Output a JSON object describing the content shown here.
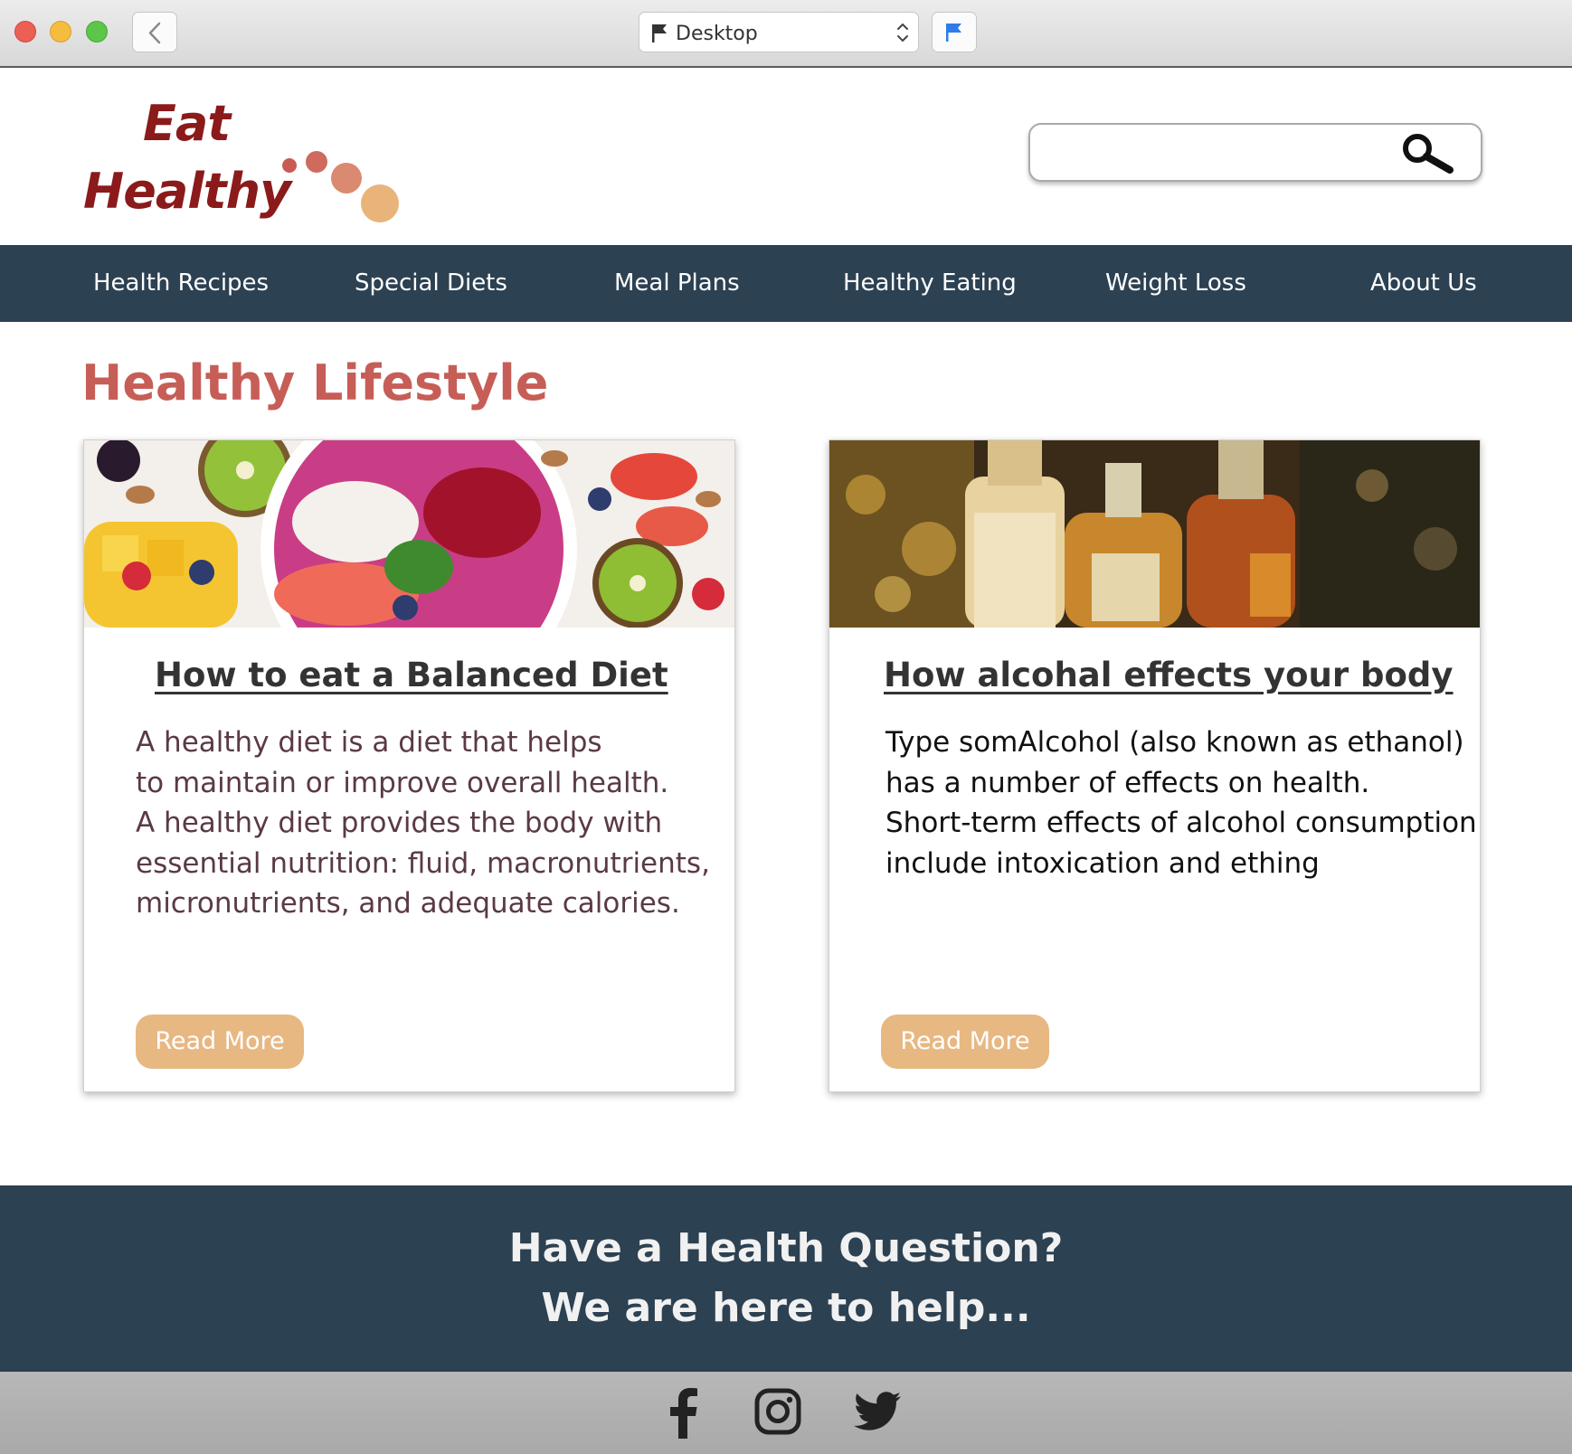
{
  "browser": {
    "device_label": "Desktop",
    "icons": [
      "back-chevron-icon",
      "flag-icon",
      "updown-icon",
      "flag-blue-icon"
    ]
  },
  "logo": {
    "line1": "Eat",
    "line2": "Healthy"
  },
  "search": {
    "placeholder": "",
    "value": ""
  },
  "nav": {
    "items": [
      {
        "label": "Health Recipes"
      },
      {
        "label": "Special Diets"
      },
      {
        "label": "Meal Plans"
      },
      {
        "label": "Healthy Eating"
      },
      {
        "label": "Weight Loss"
      },
      {
        "label": "About Us"
      }
    ]
  },
  "main": {
    "title": "Healthy Lifestyle",
    "cards": [
      {
        "title": "How to eat a Balanced Diet",
        "body_lines": [
          "A healthy diet is a diet that helps",
          "to maintain or improve overall health.",
          "A healthy diet provides the body with",
          "essential nutrition: fluid, macronutrients,",
          "micronutrients, and adequate calories."
        ],
        "button": "Read More"
      },
      {
        "title": "How alcohal effects your body",
        "body_lines": [
          "Type somAlcohol (also known as ethanol)",
          "has a number of effects on health.",
          "Short-term effects of alcohol consumption",
          "include intoxication and ething"
        ],
        "button": "Read More"
      }
    ]
  },
  "footer": {
    "line1": "Have a Health Question?",
    "line2": "We are here to help...",
    "social_icons": [
      "facebook-icon",
      "instagram-icon",
      "twitter-icon"
    ]
  },
  "colors": {
    "nav_bg": "#2c4152",
    "brand_red": "#8b1a1a",
    "title_coral": "#c65e57",
    "button_tan": "#e8b882"
  }
}
